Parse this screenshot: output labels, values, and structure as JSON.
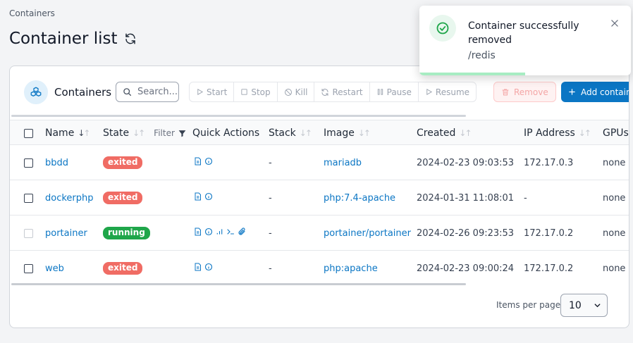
{
  "breadcrumb": "Containers",
  "page_title": "Container list",
  "card": {
    "title": "Containers",
    "search_placeholder": "Search...",
    "actions": {
      "start": "Start",
      "stop": "Stop",
      "kill": "Kill",
      "restart": "Restart",
      "pause": "Pause",
      "resume": "Resume",
      "remove": "Remove",
      "add": "Add container"
    }
  },
  "table": {
    "columns": {
      "name": "Name",
      "state": "State",
      "state_filter": "Filter",
      "quick_actions": "Quick Actions",
      "stack": "Stack",
      "image": "Image",
      "created": "Created",
      "ip": "IP Address",
      "gpus": "GPUs"
    },
    "rows": [
      {
        "name": "bbdd",
        "state": "exited",
        "stack": "-",
        "image": "mariadb",
        "created": "2024-02-23 09:03:53",
        "ip": "172.17.0.3",
        "gpus": "none"
      },
      {
        "name": "dockerphp",
        "state": "exited",
        "stack": "-",
        "image": "php:7.4-apache",
        "created": "2024-01-31 11:08:01",
        "ip": "-",
        "gpus": "none"
      },
      {
        "name": "portainer",
        "state": "running",
        "stack": "-",
        "image": "portainer/portainer",
        "created": "2024-02-26 09:23:53",
        "ip": "172.17.0.2",
        "gpus": "none"
      },
      {
        "name": "web",
        "state": "exited",
        "stack": "-",
        "image": "php:apache",
        "created": "2024-02-23 09:00:24",
        "ip": "172.17.0.2",
        "gpus": "none"
      }
    ]
  },
  "pagination": {
    "items_per_page_label": "Items per page",
    "items_per_page": "10"
  },
  "toast": {
    "title": "Container successfully removed",
    "message": "/redis",
    "progress": 0.5
  },
  "colors": {
    "primary": "#0b76c4",
    "exited": "#f06c64",
    "running": "#1fa64a"
  }
}
